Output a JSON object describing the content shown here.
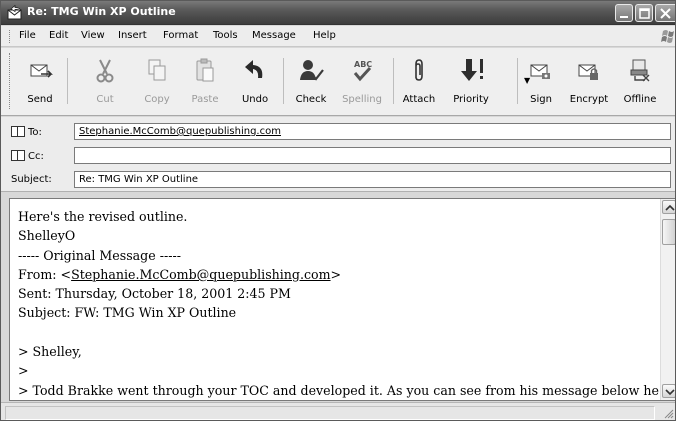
{
  "window": {
    "title": "Re: TMG Win XP Outline"
  },
  "menu": [
    "File",
    "Edit",
    "View",
    "Insert",
    "Format",
    "Tools",
    "Message",
    "Help"
  ],
  "toolbar": {
    "send": "Send",
    "cut": "Cut",
    "copy": "Copy",
    "paste": "Paste",
    "undo": "Undo",
    "check": "Check",
    "spelling": "Spelling",
    "attach": "Attach",
    "priority": "Priority",
    "sign": "Sign",
    "encrypt": "Encrypt",
    "offline": "Offline"
  },
  "headers": {
    "to_label": "To:",
    "to_value": "Stephanie.McComb@quepublishing.com",
    "cc_label": "Cc:",
    "cc_value": "",
    "subject_label": "Subject:",
    "subject_value": "Re: TMG Win XP Outline"
  },
  "body": {
    "line1": "Here's the revised outline.",
    "line2": "ShelleyO",
    "line3": "----- Original Message -----",
    "from_prefix": "From: <",
    "from_email": "Stephanie.McComb@quepublishing.com",
    "from_suffix": ">",
    "line5": "Sent: Thursday, October 18, 2001 2:45 PM",
    "line6": "Subject: FW: TMG Win XP Outline",
    "line7": "",
    "line8": "> Shelley,",
    "line9": ">",
    "line10": "> Todd Brakke went through your TOC and developed it. As you can see from his message below he"
  },
  "icons": {
    "app": "mail-reply-icon",
    "send": "send-icon",
    "cut": "scissors-icon",
    "copy": "copy-icon",
    "paste": "paste-icon",
    "undo": "undo-icon",
    "check": "check-names-icon",
    "spelling": "spelling-icon",
    "attach": "paperclip-icon",
    "priority": "priority-icon",
    "sign": "sign-icon",
    "encrypt": "encrypt-icon",
    "offline": "offline-icon"
  }
}
